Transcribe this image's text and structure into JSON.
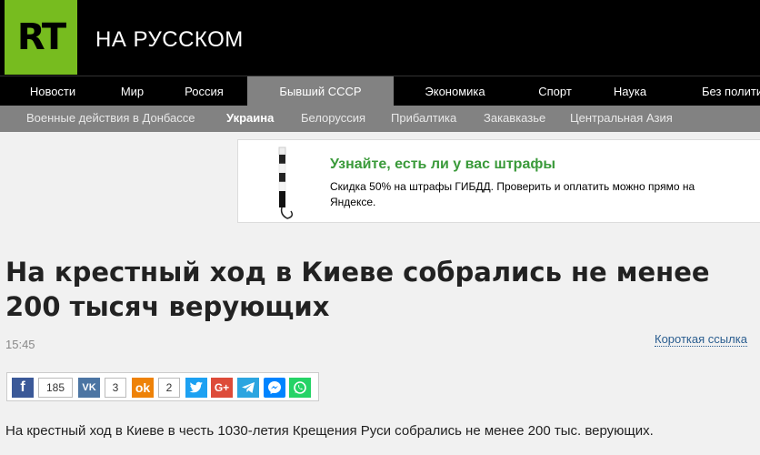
{
  "header": {
    "logo_text": "RT",
    "site_title": "НА РУССКОМ"
  },
  "nav": {
    "items": [
      "Новости",
      "Мир",
      "Россия",
      "Бывший СССР",
      "Экономика",
      "Спорт",
      "Наука",
      "Без полити"
    ],
    "active": "Бывший СССР"
  },
  "subnav": {
    "items": [
      "Военные действия в Донбассе",
      "Украина",
      "Белоруссия",
      "Прибалтика",
      "Закавказье",
      "Центральная Азия"
    ],
    "active": "Украина"
  },
  "ad": {
    "title": "Узнайте, есть ли у вас штрафы",
    "text": "Скидка 50% на штрафы ГИБДД. Проверить и оплатить можно прямо на Яндексе."
  },
  "article": {
    "headline": "На крестный ход в Киеве собрались не менее 200 тысяч верующих",
    "time": "15:45",
    "short_link": "Короткая ссылка",
    "lead": "На крестный ход в Киеве в честь 1030-летия Крещения Руси собрались не менее 200 тыс. верующих."
  },
  "share": {
    "facebook_count": "185",
    "vk_count": "3",
    "ok_count": "2"
  },
  "colors": {
    "brand_green": "#77bc1f",
    "nav_active": "#828282",
    "ad_title": "#3a9a3a"
  }
}
